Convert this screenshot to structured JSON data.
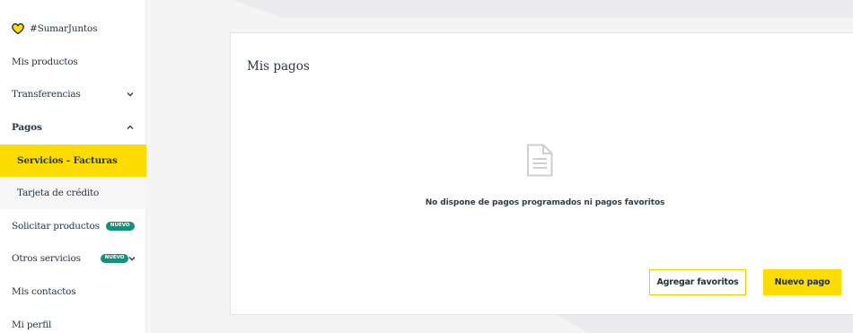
{
  "sidebar": {
    "items": [
      {
        "label": "#SumarJuntos"
      },
      {
        "label": "Mis productos"
      },
      {
        "label": "Transferencias",
        "chevron": "⌄"
      },
      {
        "label": "Pagos",
        "chevron": "^"
      },
      {
        "label": "Servicios - Facturas"
      },
      {
        "label": "Tarjeta de crédito"
      },
      {
        "label": "Solicitar productos",
        "badge": "NUEVO"
      },
      {
        "label": "Otros servicios",
        "badge": "NUEVO",
        "chevron": "⌄"
      },
      {
        "label": "Mis contactos"
      },
      {
        "label": "Mi perfil"
      }
    ]
  },
  "main": {
    "title": "Mis pagos",
    "empty_icon": "document-icon",
    "empty_message": "No dispone de pagos programados ni pagos favoritos",
    "buttons": {
      "add_favorites": "Agregar favoritos",
      "new_payment": "Nuevo pago"
    }
  },
  "colors": {
    "accent": "#fddc00",
    "badge": "#16907b",
    "background": "#f4f4f5"
  }
}
